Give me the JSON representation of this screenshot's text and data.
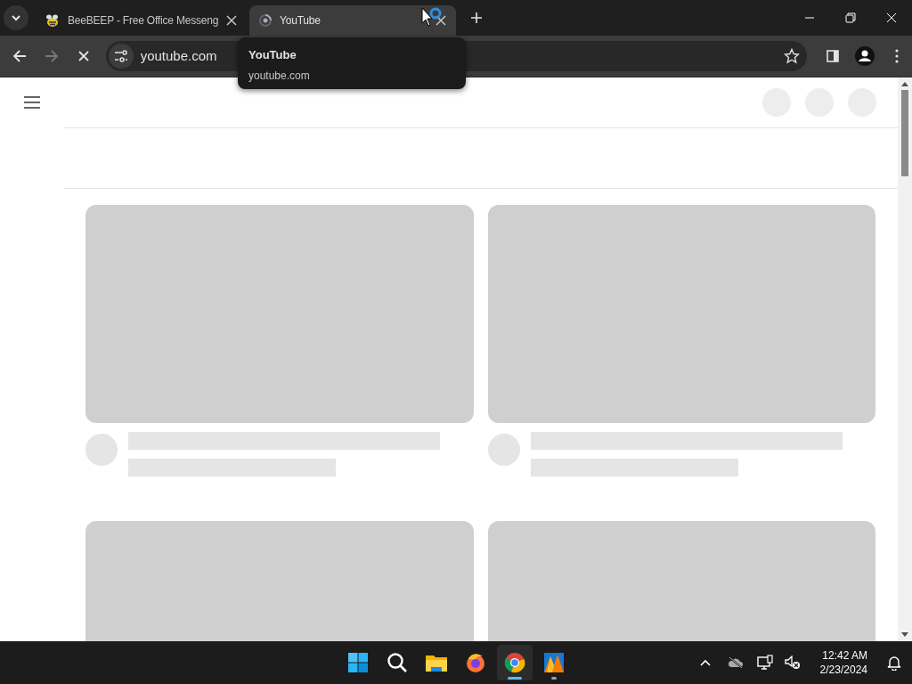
{
  "tabs": [
    {
      "title": "BeeBEEP - Free Office Messeng",
      "selected": false,
      "loading": false
    },
    {
      "title": "YouTube",
      "selected": true,
      "loading": true
    }
  ],
  "tooltip": {
    "title": "YouTube",
    "url": "youtube.com"
  },
  "address_bar": {
    "value": "youtube.com",
    "loading": true
  },
  "page": {
    "loading": true
  },
  "taskbar": {
    "apps": [
      {
        "kind": "start",
        "selected": false,
        "running": false
      },
      {
        "kind": "search",
        "selected": false,
        "running": false
      },
      {
        "kind": "explorer",
        "selected": false,
        "running": false
      },
      {
        "kind": "firefox",
        "selected": false,
        "running": false
      },
      {
        "kind": "chrome",
        "selected": true,
        "running": true
      },
      {
        "kind": "app",
        "selected": false,
        "running": true
      }
    ],
    "time": "12:42 AM",
    "date": "2/23/2024"
  }
}
